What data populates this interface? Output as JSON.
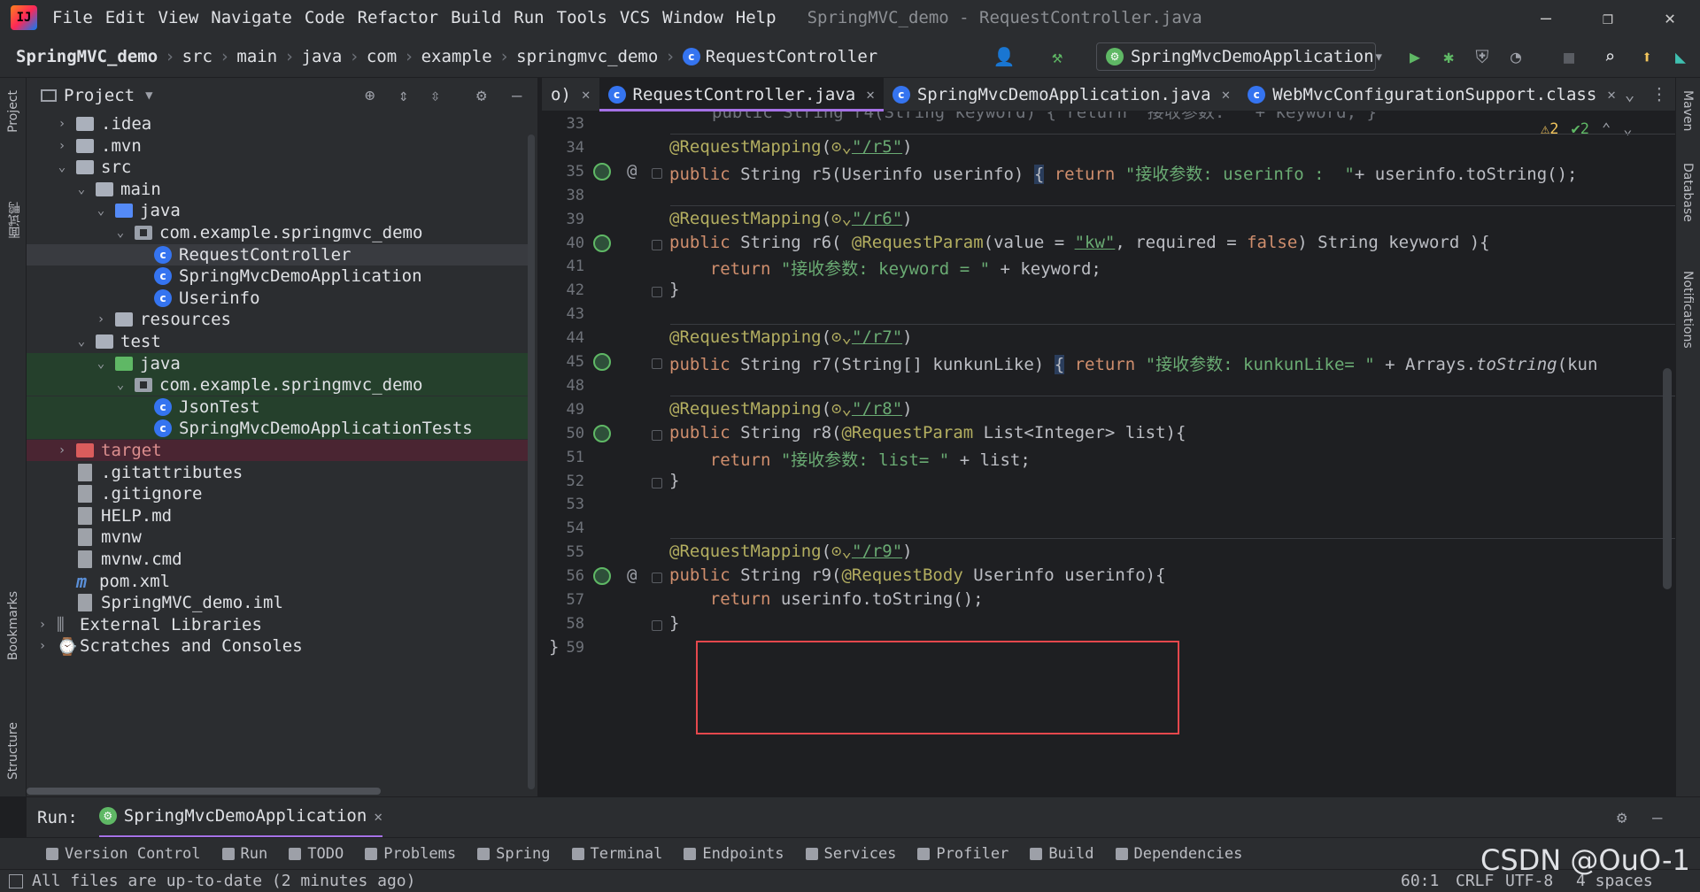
{
  "menubar": {
    "items": [
      "File",
      "Edit",
      "View",
      "Navigate",
      "Code",
      "Refactor",
      "Build",
      "Run",
      "Tools",
      "VCS",
      "Window",
      "Help"
    ],
    "title": "SpringMVC_demo - RequestController.java"
  },
  "navbar": {
    "crumbs": [
      "SpringMVC_demo",
      "src",
      "main",
      "java",
      "com",
      "example",
      "springmvc_demo",
      "RequestController"
    ],
    "run_config": "SpringMvcDemoApplication"
  },
  "left_strip": {
    "project_label": "Project",
    "cn_label": "面试鸭",
    "bookmarks_label": "Bookmarks",
    "structure_label": "Structure"
  },
  "right_strip": {
    "maven": "Maven",
    "database": "Database",
    "notifications": "Notifications"
  },
  "project": {
    "title": "Project",
    "tree": [
      {
        "label": ".idea",
        "kind": "folder",
        "depth": 1,
        "arrow": "›"
      },
      {
        "label": ".mvn",
        "kind": "folder",
        "depth": 1,
        "arrow": "›"
      },
      {
        "label": "src",
        "kind": "folder",
        "depth": 1,
        "arrow": "⌄"
      },
      {
        "label": "main",
        "kind": "folder",
        "depth": 2,
        "arrow": "⌄"
      },
      {
        "label": "java",
        "kind": "folder-blue",
        "depth": 3,
        "arrow": "⌄"
      },
      {
        "label": "com.example.springmvc_demo",
        "kind": "pkg",
        "depth": 4,
        "arrow": "⌄"
      },
      {
        "label": "RequestController",
        "kind": "class",
        "depth": 5,
        "arrow": "",
        "selected": true
      },
      {
        "label": "SpringMvcDemoApplication",
        "kind": "class",
        "depth": 5,
        "arrow": ""
      },
      {
        "label": "Userinfo",
        "kind": "class",
        "depth": 5,
        "arrow": ""
      },
      {
        "label": "resources",
        "kind": "folder",
        "depth": 3,
        "arrow": "›"
      },
      {
        "label": "test",
        "kind": "folder",
        "depth": 2,
        "arrow": "⌄"
      },
      {
        "label": "java",
        "kind": "folder-green",
        "depth": 3,
        "arrow": "⌄",
        "test": true
      },
      {
        "label": "com.example.springmvc_demo",
        "kind": "pkg",
        "depth": 4,
        "arrow": "⌄",
        "test": true
      },
      {
        "label": "JsonTest",
        "kind": "class",
        "depth": 5,
        "arrow": "",
        "test": true
      },
      {
        "label": "SpringMvcDemoApplicationTests",
        "kind": "class",
        "depth": 5,
        "arrow": "",
        "test": true
      },
      {
        "label": "target",
        "kind": "folder-red",
        "depth": 1,
        "arrow": "›",
        "excluded": true
      },
      {
        "label": ".gitattributes",
        "kind": "file",
        "depth": 1,
        "arrow": ""
      },
      {
        "label": ".gitignore",
        "kind": "file",
        "depth": 1,
        "arrow": ""
      },
      {
        "label": "HELP.md",
        "kind": "file",
        "depth": 1,
        "arrow": ""
      },
      {
        "label": "mvnw",
        "kind": "file",
        "depth": 1,
        "arrow": ""
      },
      {
        "label": "mvnw.cmd",
        "kind": "file",
        "depth": 1,
        "arrow": ""
      },
      {
        "label": "pom.xml",
        "kind": "maven",
        "depth": 1,
        "arrow": ""
      },
      {
        "label": "SpringMVC_demo.iml",
        "kind": "file",
        "depth": 1,
        "arrow": ""
      },
      {
        "label": "External Libraries",
        "kind": "lib",
        "depth": 0,
        "arrow": "›"
      },
      {
        "label": "Scratches and Consoles",
        "kind": "scratch",
        "depth": 0,
        "arrow": "›"
      }
    ]
  },
  "tabs": [
    {
      "label": "o)",
      "partial": true
    },
    {
      "label": "RequestController.java",
      "active": true
    },
    {
      "label": "SpringMvcDemoApplication.java"
    },
    {
      "label": "WebMvcConfigurationSupport.class"
    }
  ],
  "inspections": {
    "warnings": "2",
    "ok": "2"
  },
  "code": [
    {
      "n": "33",
      "html": ""
    },
    {
      "n": "34",
      "html": "<span class='ann'>@RequestMapping</span>(<span class='ann'>⊙⌄</span><span class='strurl'>\"/r5\"</span>)"
    },
    {
      "n": "35",
      "html": "<span class='kw'>public</span> String r5(Userinfo userinfo) <span class='brace-hl'>{</span> <span class='kw'>return</span> <span class='str'>\"接收参数: userinfo :  \"</span>+ userinfo.toString();"
    },
    {
      "n": "38",
      "html": ""
    },
    {
      "n": "39",
      "html": "<span class='ann'>@RequestMapping</span>(<span class='ann'>⊙⌄</span><span class='strurl'>\"/r6\"</span>)"
    },
    {
      "n": "40",
      "html": "<span class='kw'>public</span> String r6( <span class='ann'>@RequestParam</span>(value = <span class='strurl'>\"kw\"</span>, required = <span class='kw'>false</span>) String keyword ){"
    },
    {
      "n": "41",
      "html": "    <span class='kw'>return</span> <span class='str'>\"接收参数: keyword = \"</span> + keyword;"
    },
    {
      "n": "42",
      "html": "}"
    },
    {
      "n": "43",
      "html": ""
    },
    {
      "n": "44",
      "html": "<span class='ann'>@RequestMapping</span>(<span class='ann'>⊙⌄</span><span class='strurl'>\"/r7\"</span>)"
    },
    {
      "n": "45",
      "html": "<span class='kw'>public</span> String r7(String[] kunkunLike) <span class='brace-hl'>{</span> <span class='kw'>return</span> <span class='str'>\"接收参数: kunkunLike= \"</span> + Arrays.<i>toString</i>(kun"
    },
    {
      "n": "48",
      "html": ""
    },
    {
      "n": "49",
      "html": "<span class='ann'>@RequestMapping</span>(<span class='ann'>⊙⌄</span><span class='strurl'>\"/r8\"</span>)"
    },
    {
      "n": "50",
      "html": "<span class='kw'>public</span> String r8(<span class='ann'>@RequestParam</span> List&lt;Integer&gt; list){"
    },
    {
      "n": "51",
      "html": "    <span class='kw'>return</span> <span class='str'>\"接收参数: list= \"</span> + list;"
    },
    {
      "n": "52",
      "html": "}"
    },
    {
      "n": "53",
      "html": ""
    },
    {
      "n": "54",
      "html": ""
    },
    {
      "n": "55",
      "html": "<span class='ann'>@RequestMapping</span>(<span class='ann'>⊙⌄</span><span class='strurl'>\"/r9\"</span>)"
    },
    {
      "n": "56",
      "html": "<span class='kw'>public</span> String r9(<span class='ann'>@RequestBody</span> Userinfo userinfo){"
    },
    {
      "n": "57",
      "html": "    <span class='kw'>return</span> userinfo.toString();"
    },
    {
      "n": "58",
      "html": "}"
    },
    {
      "n": "59",
      "html": "}"
    }
  ],
  "first_line_partial": "public String r4(String keyword) { return \"接收参数: \" + keyword; }",
  "runbar": {
    "label": "Run:",
    "config": "SpringMvcDemoApplication"
  },
  "bottom_tabs": [
    "Version Control",
    "Run",
    "TODO",
    "Problems",
    "Spring",
    "Terminal",
    "Endpoints",
    "Services",
    "Profiler",
    "Build",
    "Dependencies"
  ],
  "status": {
    "message": "All files are up-to-date (2 minutes ago)",
    "position": "60:1",
    "line_sep": "CRLF",
    "encoding": "UTF-8",
    "indent": "4 spaces",
    "watermark": "CSDN @OuO-1"
  },
  "colors": {
    "accent": "#a571e6",
    "highlight_box": "#e5484d",
    "keyword": "#cf8e6d",
    "string": "#6aab73",
    "annotation": "#b3ae60"
  }
}
